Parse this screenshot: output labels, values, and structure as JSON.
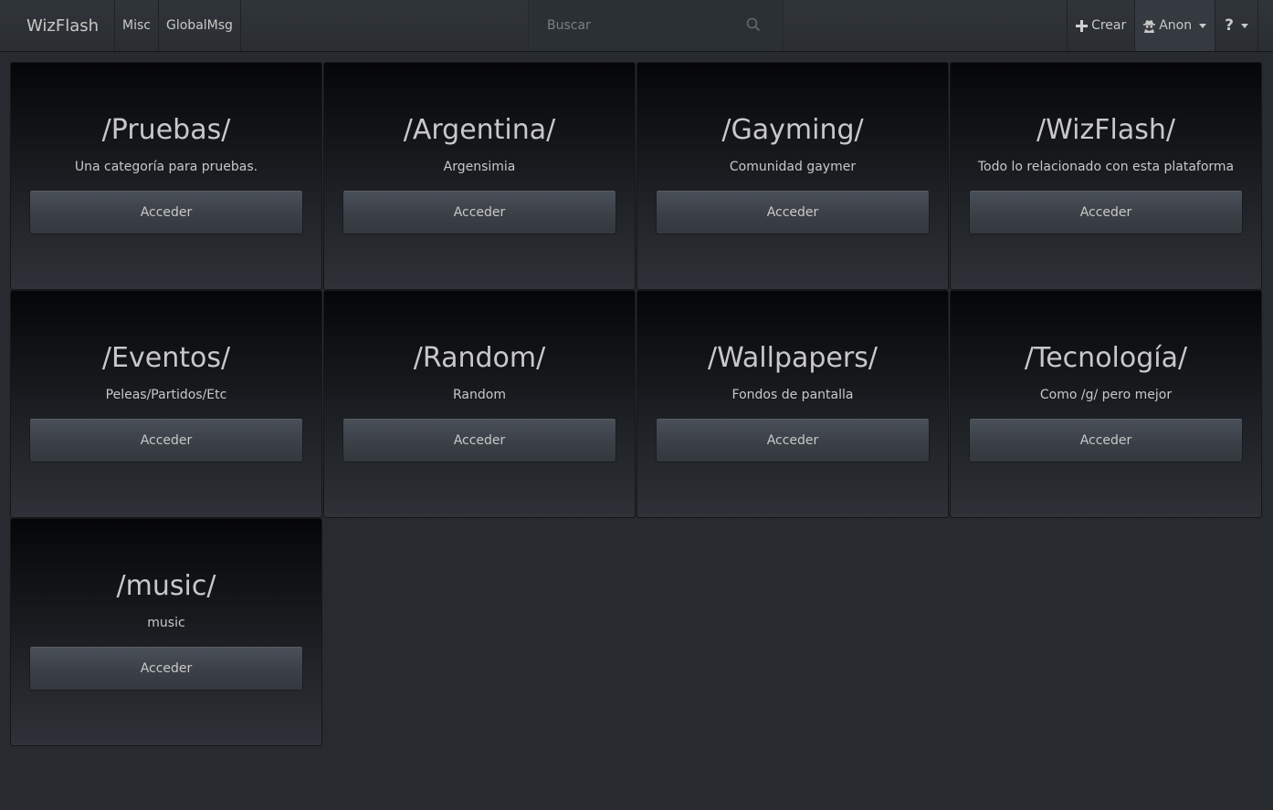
{
  "navbar": {
    "brand": "WizFlash",
    "links": [
      "Misc",
      "GlobalMsg"
    ],
    "search_placeholder": "Buscar",
    "create_label": "Crear",
    "user_label": "Anon",
    "help_label": "?"
  },
  "categories": [
    {
      "title": "/Pruebas/",
      "description": "Una categoría para pruebas.",
      "button": "Acceder"
    },
    {
      "title": "/Argentina/",
      "description": "Argensimia",
      "button": "Acceder"
    },
    {
      "title": "/Gayming/",
      "description": "Comunidad gaymer",
      "button": "Acceder"
    },
    {
      "title": "/WizFlash/",
      "description": "Todo lo relacionado con esta plataforma",
      "button": "Acceder"
    },
    {
      "title": "/Eventos/",
      "description": "Peleas/Partidos/Etc",
      "button": "Acceder"
    },
    {
      "title": "/Random/",
      "description": "Random",
      "button": "Acceder"
    },
    {
      "title": "/Wallpapers/",
      "description": "Fondos de pantalla",
      "button": "Acceder"
    },
    {
      "title": "/Tecnología/",
      "description": "Como /g/ pero mejor",
      "button": "Acceder"
    },
    {
      "title": "/music/",
      "description": "music",
      "button": "Acceder"
    }
  ],
  "colors": {
    "background": "#272b30",
    "navbar": "#2e3338",
    "text": "#c8c8c8"
  }
}
